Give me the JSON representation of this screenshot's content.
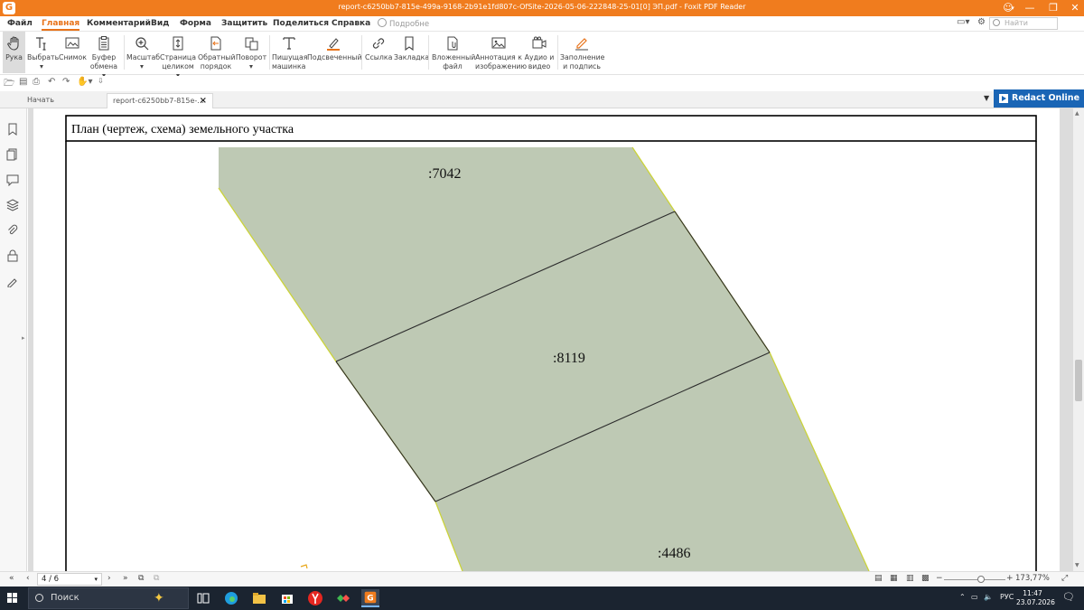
{
  "window": {
    "title": "report-c6250bb7-815e-499a-9168-2b91e1fd807c-OfSite-2026-05-06-222848-25-01[0] ЭП.pdf - Foxit PDF Reader",
    "app_logo": "G"
  },
  "menu": {
    "items": [
      "Файл",
      "Главная",
      "Комментарий",
      "Вид",
      "Форма",
      "Защитить",
      "Поделиться",
      "Справка"
    ],
    "active": "Главная",
    "search_hint": "Подробне",
    "find_placeholder": "Найти"
  },
  "ribbon": {
    "buttons": [
      {
        "label": "Рука",
        "icon": "hand-icon"
      },
      {
        "label": "Выбрать ▾",
        "icon": "select-text-icon"
      },
      {
        "label": "Снимок",
        "icon": "snapshot-icon"
      },
      {
        "label": "Буфер обмена ▾",
        "icon": "clipboard-icon"
      },
      {
        "label": "Масштаб ▾",
        "icon": "zoom-icon"
      },
      {
        "label": "Страница целиком ▾",
        "icon": "fit-page-icon"
      },
      {
        "label": "Обратный порядок",
        "icon": "reverse-order-icon"
      },
      {
        "label": "Поворот ▾",
        "icon": "rotate-icon"
      },
      {
        "label": "Пишущая машинка",
        "icon": "typewriter-icon"
      },
      {
        "label": "Подсвеченный",
        "icon": "highlight-icon"
      },
      {
        "label": "Ссылка",
        "icon": "link-icon"
      },
      {
        "label": "Закладка",
        "icon": "bookmark-icon"
      },
      {
        "label": "Вложенный файл",
        "icon": "attachment-file-icon"
      },
      {
        "label": "Аннотация к изображению",
        "icon": "image-annotation-icon"
      },
      {
        "label": "Аудио и видео",
        "icon": "audio-video-icon"
      },
      {
        "label": "Заполнение и подпись",
        "icon": "fill-sign-icon"
      }
    ]
  },
  "tabs": {
    "start_label": "Начать",
    "doc_label": "report-c6250bb7-815e-...",
    "close_glyph": "×",
    "redact_label": "Redact Online"
  },
  "document": {
    "heading": "План (чертеж, схема) земельного участка",
    "parcels": [
      {
        "label": ":7042",
        "fill": "#bec9b4"
      },
      {
        "label": ":8119",
        "fill": "#bec9b4"
      },
      {
        "label": ":4486",
        "fill": "#bec9b4"
      }
    ],
    "boundary_color": "#cbd33a",
    "divider_color": "#2c2c2c"
  },
  "status": {
    "page_indicator": "4 / 6",
    "zoom": "173,77%"
  },
  "taskbar": {
    "search_placeholder": "Поиск",
    "lang": "РУС",
    "time": "11:47",
    "date": "23.07.2026"
  }
}
